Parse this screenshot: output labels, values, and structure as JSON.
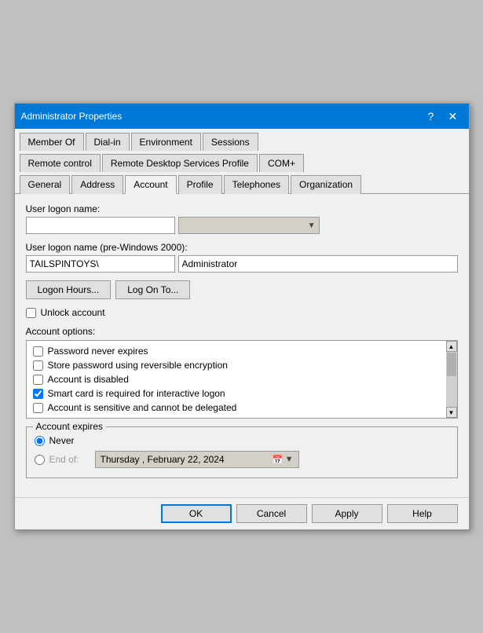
{
  "dialog": {
    "title": "Administrator Properties",
    "help_btn": "?",
    "close_btn": "✕"
  },
  "tabs": {
    "row1": [
      {
        "label": "Member Of",
        "active": false
      },
      {
        "label": "Dial-in",
        "active": false
      },
      {
        "label": "Environment",
        "active": false
      },
      {
        "label": "Sessions",
        "active": false
      }
    ],
    "row2": [
      {
        "label": "Remote control",
        "active": false
      },
      {
        "label": "Remote Desktop Services Profile",
        "active": false
      },
      {
        "label": "COM+",
        "active": false
      }
    ],
    "row3": [
      {
        "label": "General",
        "active": false
      },
      {
        "label": "Address",
        "active": false
      },
      {
        "label": "Account",
        "active": true
      },
      {
        "label": "Profile",
        "active": false
      },
      {
        "label": "Telephones",
        "active": false
      },
      {
        "label": "Organization",
        "active": false
      }
    ]
  },
  "account_tab": {
    "logon_name_label": "User logon name:",
    "logon_name_value": "",
    "logon_name_placeholder": "",
    "logon_name_domain_placeholder": "",
    "pre_windows_label": "User logon name (pre-Windows 2000):",
    "pre_windows_domain": "TAILSPINTOYS\\",
    "pre_windows_user": "Administrator",
    "logon_hours_btn": "Logon Hours...",
    "log_on_to_btn": "Log On To...",
    "unlock_label": "Unlock account",
    "unlock_checked": false,
    "account_options_label": "Account options:",
    "options": [
      {
        "label": "Password never expires",
        "checked": false
      },
      {
        "label": "Store password using reversible encryption",
        "checked": false
      },
      {
        "label": "Account is disabled",
        "checked": false
      },
      {
        "label": "Smart card is required for interactive logon",
        "checked": true
      },
      {
        "label": "Account is sensitive and cannot be delegated",
        "checked": false
      }
    ],
    "expires_group_label": "Account expires",
    "never_label": "Never",
    "never_checked": true,
    "end_of_label": "End of:",
    "end_of_checked": false,
    "date_value": "Thursday ,  February  22, 2024"
  },
  "buttons": {
    "ok": "OK",
    "cancel": "Cancel",
    "apply": "Apply",
    "help": "Help"
  }
}
